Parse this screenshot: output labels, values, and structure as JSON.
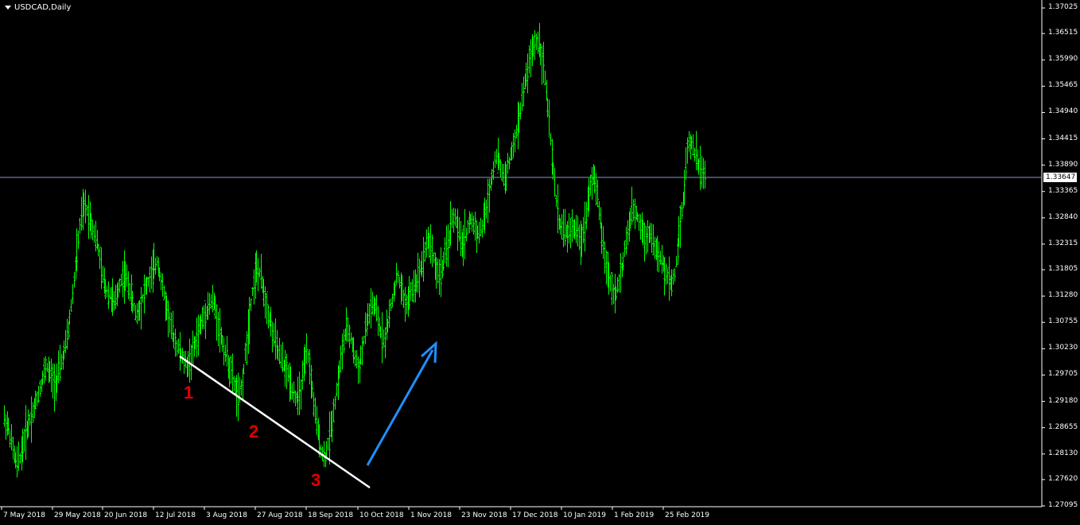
{
  "window": {
    "symbol_title": "USDCAD,Daily"
  },
  "colors": {
    "background": "#000000",
    "candles": "#00ff00",
    "axis": "#ffffff",
    "price_line": "#8a9ac8",
    "trend_line": "#ffffff",
    "arrow": "#1e90ff",
    "wave_labels": "#e00000"
  },
  "current_price": "1.33647",
  "wave_labels": [
    "1",
    "2",
    "3"
  ],
  "chart_data": {
    "type": "candlestick",
    "title": "USDCAD,Daily",
    "ylim": [
      1.2695,
      1.371
    ],
    "y_ticks": [
      "1.37025",
      "1.36515",
      "1.35990",
      "1.35465",
      "1.34940",
      "1.34415",
      "1.33890",
      "1.33365",
      "1.32840",
      "1.32315",
      "1.31805",
      "1.31280",
      "1.30755",
      "1.30230",
      "1.29705",
      "1.29180",
      "1.28655",
      "1.28130",
      "1.27620",
      "1.27095"
    ],
    "x_ticks": [
      "7 May 2018",
      "29 May 2018",
      "20 Jun 2018",
      "12 Jul 2018",
      "3 Aug 2018",
      "27 Aug 2018",
      "18 Sep 2018",
      "10 Oct 2018",
      "1 Nov 2018",
      "23 Nov 2018",
      "17 Dec 2018",
      "10 Jan 2019",
      "1 Feb 2019",
      "25 Feb 2019"
    ],
    "closes": [
      1.287,
      1.283,
      1.279,
      1.281,
      1.285,
      1.288,
      1.29,
      1.293,
      1.296,
      1.299,
      1.297,
      1.295,
      1.298,
      1.301,
      1.305,
      1.312,
      1.32,
      1.328,
      1.331,
      1.329,
      1.326,
      1.323,
      1.317,
      1.314,
      1.313,
      1.311,
      1.315,
      1.317,
      1.316,
      1.312,
      1.309,
      1.311,
      1.314,
      1.316,
      1.318,
      1.32,
      1.315,
      1.311,
      1.307,
      1.304,
      1.302,
      1.3,
      1.299,
      1.301,
      1.304,
      1.307,
      1.309,
      1.311,
      1.312,
      1.308,
      1.304,
      1.301,
      1.298,
      1.295,
      1.292,
      1.297,
      1.305,
      1.313,
      1.318,
      1.317,
      1.313,
      1.309,
      1.305,
      1.302,
      1.3,
      1.298,
      1.296,
      1.293,
      1.292,
      1.297,
      1.302,
      1.295,
      1.288,
      1.283,
      1.28,
      1.284,
      1.289,
      1.295,
      1.301,
      1.306,
      1.305,
      1.301,
      1.298,
      1.303,
      1.308,
      1.311,
      1.31,
      1.306,
      1.304,
      1.308,
      1.313,
      1.317,
      1.314,
      1.311,
      1.313,
      1.315,
      1.317,
      1.32,
      1.324,
      1.323,
      1.318,
      1.317,
      1.32,
      1.324,
      1.329,
      1.327,
      1.323,
      1.325,
      1.328,
      1.327,
      1.325,
      1.327,
      1.331,
      1.336,
      1.341,
      1.339,
      1.336,
      1.339,
      1.342,
      1.346,
      1.351,
      1.356,
      1.36,
      1.363,
      1.364,
      1.36,
      1.352,
      1.342,
      1.333,
      1.327,
      1.326,
      1.325,
      1.327,
      1.325,
      1.324,
      1.328,
      1.335,
      1.337,
      1.331,
      1.324,
      1.318,
      1.315,
      1.313,
      1.316,
      1.321,
      1.326,
      1.33,
      1.329,
      1.327,
      1.324,
      1.326,
      1.323,
      1.321,
      1.319,
      1.317,
      1.315,
      1.318,
      1.327,
      1.333,
      1.344,
      1.343,
      1.34,
      1.338,
      1.3365
    ],
    "annotations": [
      "descending white trend line under swing lows",
      "wave labels 1, 2, 3",
      "blue upward arrow"
    ]
  }
}
